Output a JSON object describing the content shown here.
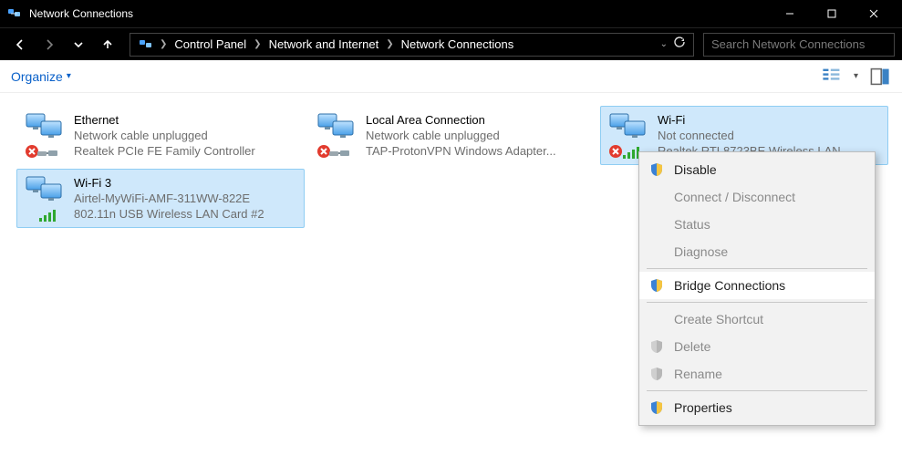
{
  "window": {
    "title": "Network Connections"
  },
  "breadcrumb": {
    "items": [
      "Control Panel",
      "Network and Internet",
      "Network Connections"
    ]
  },
  "search": {
    "placeholder": "Search Network Connections"
  },
  "toolbar": {
    "organize_label": "Organize"
  },
  "connections": [
    {
      "name": "Ethernet",
      "status": "Network cable unplugged",
      "device": "Realtek PCIe FE Family Controller",
      "kind": "wired",
      "error": true,
      "selected": false
    },
    {
      "name": "Local Area Connection",
      "status": "Network cable unplugged",
      "device": "TAP-ProtonVPN Windows Adapter...",
      "kind": "wired",
      "error": true,
      "selected": false
    },
    {
      "name": "Wi-Fi",
      "status": "Not connected",
      "device": "Realtek RTL8723BE Wireless LAN",
      "kind": "wifi",
      "error": true,
      "selected": true
    },
    {
      "name": "Wi-Fi 3",
      "status": "Airtel-MyWiFi-AMF-311WW-822E",
      "device": "802.11n USB Wireless LAN Card #2",
      "kind": "wifi",
      "error": false,
      "selected": true
    }
  ],
  "context_menu": {
    "items": [
      {
        "label": "Disable",
        "shield": true,
        "disabled": false
      },
      {
        "label": "Connect / Disconnect",
        "shield": false,
        "disabled": true
      },
      {
        "label": "Status",
        "shield": false,
        "disabled": true
      },
      {
        "label": "Diagnose",
        "shield": false,
        "disabled": true
      },
      {
        "sep": true
      },
      {
        "label": "Bridge Connections",
        "shield": true,
        "disabled": false,
        "hovered": true
      },
      {
        "sep": true
      },
      {
        "label": "Create Shortcut",
        "shield": false,
        "disabled": true
      },
      {
        "label": "Delete",
        "shield": true,
        "disabled": true
      },
      {
        "label": "Rename",
        "shield": true,
        "disabled": true
      },
      {
        "sep": true
      },
      {
        "label": "Properties",
        "shield": true,
        "disabled": false
      }
    ]
  }
}
